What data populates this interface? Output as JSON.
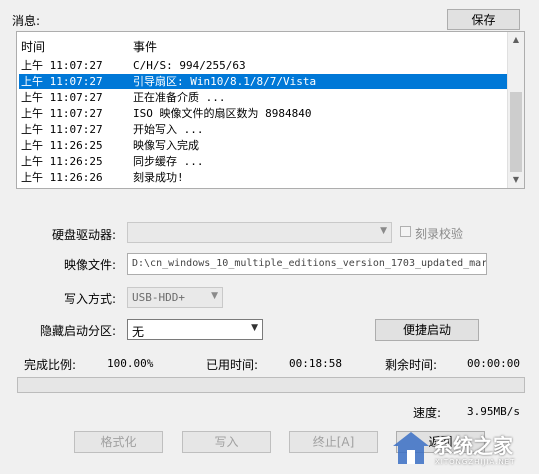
{
  "log": {
    "label": "消息:",
    "save_button": "保存",
    "col_time": "时间",
    "col_event": "事件",
    "rows": [
      {
        "time": "上午 11:07:27",
        "event": "C/H/S: 994/255/63"
      },
      {
        "time": "上午 11:07:27",
        "event": "引导扇区: Win10/8.1/8/7/Vista"
      },
      {
        "time": "上午 11:07:27",
        "event": "正在准备介质 ..."
      },
      {
        "time": "上午 11:07:27",
        "event": "ISO 映像文件的扇区数为 8984840"
      },
      {
        "time": "上午 11:07:27",
        "event": "开始写入 ..."
      },
      {
        "time": "上午 11:26:25",
        "event": "映像写入完成"
      },
      {
        "time": "上午 11:26:25",
        "event": "同步缓存 ..."
      },
      {
        "time": "上午 11:26:26",
        "event": "刻录成功!"
      }
    ]
  },
  "form": {
    "drive_label": "硬盘驱动器:",
    "drive_value": "",
    "verify_label": "刻录校验",
    "image_label": "映像文件:",
    "image_value": "D:\\cn_windows_10_multiple_editions_version_1703_updated_mar",
    "write_mode_label": "写入方式:",
    "write_mode_value": "USB-HDD+",
    "hide_partition_label": "隐藏启动分区:",
    "hide_partition_value": "无",
    "quick_boot_button": "便捷启动"
  },
  "status": {
    "ratio_label": "完成比例:",
    "ratio_value": "100.00%",
    "elapsed_label": "已用时间:",
    "elapsed_value": "00:18:58",
    "remaining_label": "剩余时间:",
    "remaining_value": "00:00:00",
    "speed_label": "速度:",
    "speed_value": "3.95MB/s",
    "progress_fraction": 0
  },
  "actions": {
    "format_button": "格式化",
    "write_button": "写入",
    "stop_button": "终止[A]",
    "back_button": "返回"
  },
  "watermark": {
    "text": "系统之家",
    "subtext": "XITONGZHIJIA.NET"
  }
}
